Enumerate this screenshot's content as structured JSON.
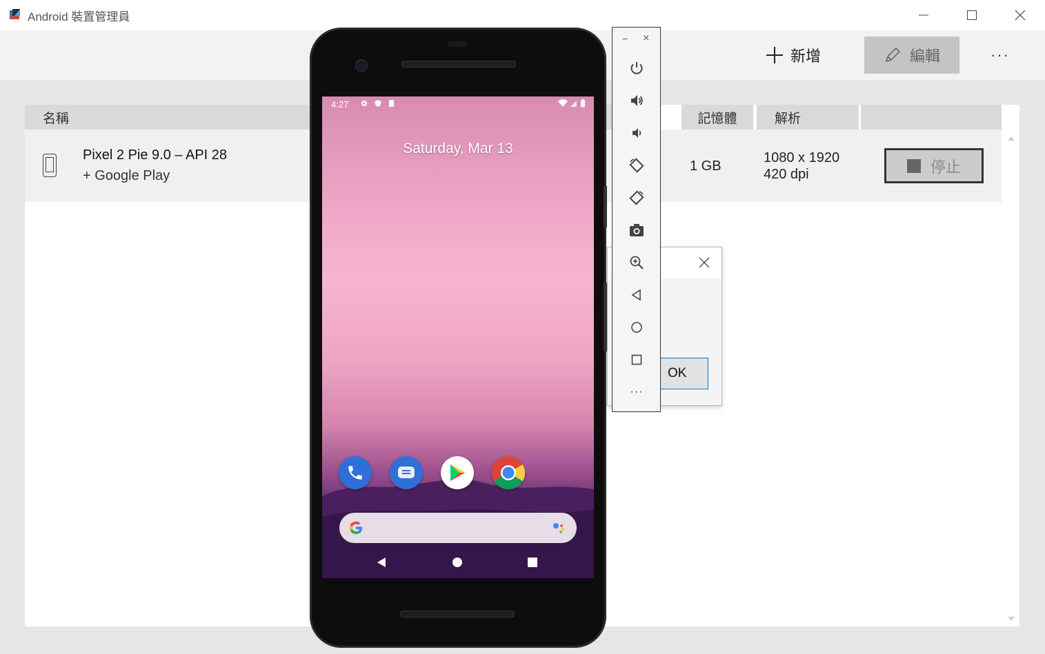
{
  "window": {
    "title": "Android 裝置管理員",
    "minimize": "—",
    "maximize": "☐",
    "close": "✕"
  },
  "toolbar": {
    "add_label": "新增",
    "edit_label": "編輯",
    "more_label": "···"
  },
  "table": {
    "headers": {
      "name": "名稱",
      "memory": "記憶體",
      "resolution": "解析"
    },
    "rows": [
      {
        "name": "Pixel 2 Pie 9.0 – API 28",
        "subtitle": "+ Google Play",
        "memory": "1 GB",
        "resolution_line1": "1080 x 1920",
        "resolution_line2": "420 dpi",
        "action_label": "停止"
      }
    ]
  },
  "dialog": {
    "ok_label": "OK"
  },
  "emulator": {
    "status_time": "4:27",
    "date_text": "Saturday, Mar 13",
    "dock_apps": [
      "phone-app",
      "messages-app",
      "play-store-app",
      "chrome-app"
    ],
    "toolbar_buttons": [
      "power",
      "volume-up",
      "volume-down",
      "rotate-left",
      "rotate-right",
      "screenshot",
      "zoom",
      "back",
      "home",
      "overview",
      "more"
    ],
    "top_minimize": "−",
    "top_close": "×",
    "more_dots": "···"
  },
  "colors": {
    "edit_button_bg": "#c4c4c4",
    "header_bg": "#d9d9d9",
    "row_bg": "#f0f0f0",
    "accent": "#0078d7"
  }
}
